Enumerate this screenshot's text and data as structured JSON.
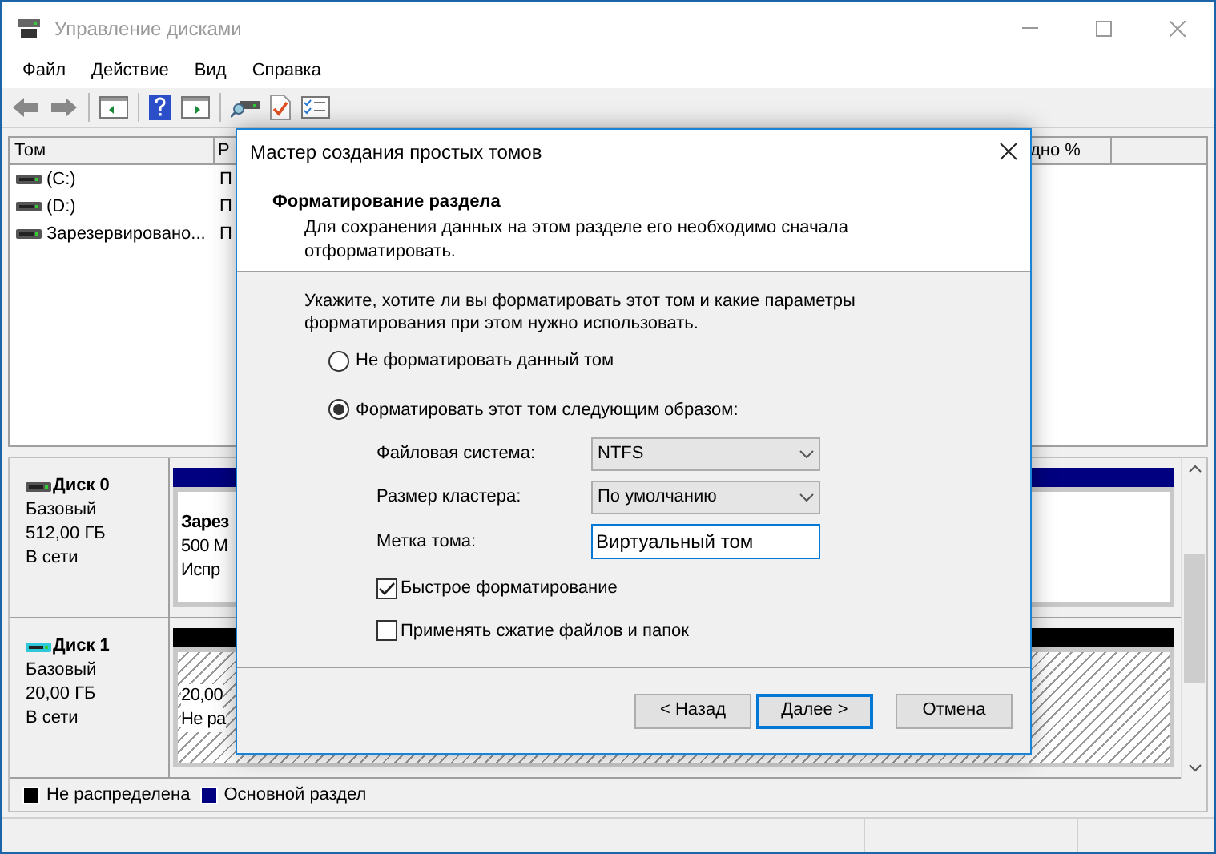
{
  "window": {
    "title": "Управление дисками"
  },
  "menu": [
    "Файл",
    "Действие",
    "Вид",
    "Справка"
  ],
  "volume_table": {
    "columns": [
      "Том",
      "Р",
      "дно %"
    ],
    "rows": [
      {
        "name": "(C:)",
        "column_2": "П"
      },
      {
        "name": "(D:)",
        "column_2": "П"
      },
      {
        "name": "Зарезервировано...",
        "column_2": "П"
      }
    ]
  },
  "disks": [
    {
      "name": "Диск 0",
      "type": "Базовый",
      "size": "512,00 ГБ",
      "status": "В сети",
      "kind": "primary",
      "partition_lines": [
        "Зарез",
        "500 М",
        "Испр"
      ]
    },
    {
      "name": "Диск 1",
      "type": "Базовый",
      "size": "20,00 ГБ",
      "status": "В сети",
      "kind": "unallocated",
      "partition_lines": [
        "20,00",
        "Не ра"
      ]
    }
  ],
  "legend": [
    {
      "label": "Не распределена",
      "color": "#000000"
    },
    {
      "label": "Основной раздел",
      "color": "#000080"
    }
  ],
  "dialog": {
    "title": "Мастер создания простых томов",
    "heading": "Форматирование раздела",
    "subheading": "Для сохранения данных на этом разделе его необходимо сначала отформатировать.",
    "prompt": "Укажите, хотите ли вы форматировать этот том и какие параметры форматирования при этом нужно использовать.",
    "options": [
      {
        "label": "Не форматировать данный том",
        "selected": false
      },
      {
        "label": "Форматировать этот том следующим образом:",
        "selected": true
      }
    ],
    "fields": [
      {
        "label": "Файловая система:",
        "kind": "dropdown",
        "value": "NTFS"
      },
      {
        "label": "Размер кластера:",
        "kind": "dropdown",
        "value": "По умолчанию"
      },
      {
        "label": "Метка тома:",
        "kind": "text",
        "value": "Виртуальный том"
      }
    ],
    "checkboxes": [
      {
        "label": "Быстрое форматирование",
        "checked": true
      },
      {
        "label": "Применять сжатие файлов и папок",
        "checked": false
      }
    ],
    "buttons": [
      {
        "label": "< Назад",
        "default": false
      },
      {
        "label": "Далее >",
        "default": true
      },
      {
        "label": "Отмена",
        "default": false
      }
    ]
  }
}
